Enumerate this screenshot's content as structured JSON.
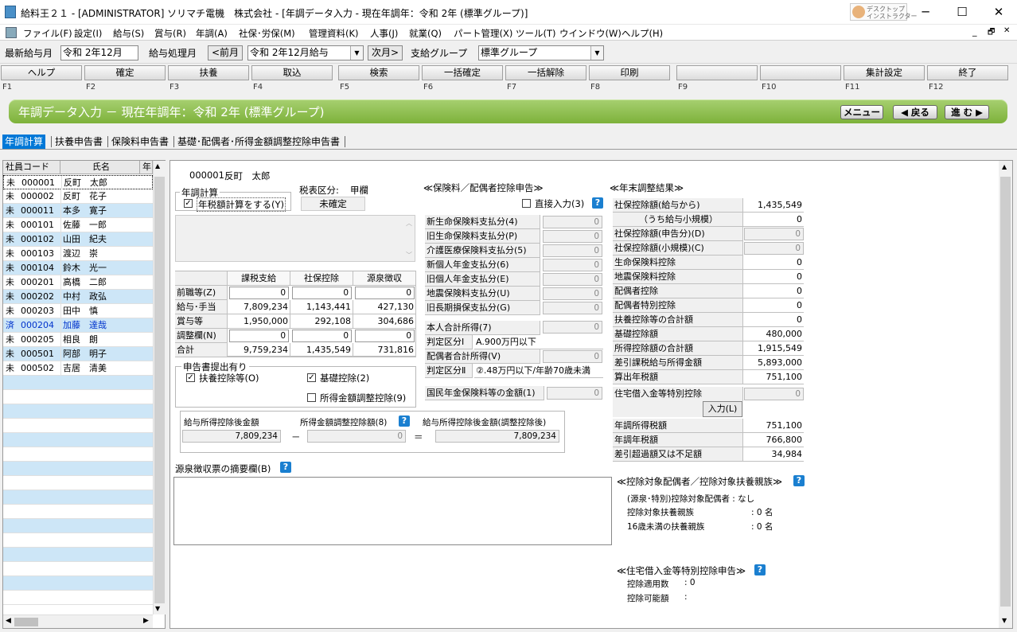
{
  "window": {
    "title": "給料王２１ - [ADMINISTRATOR] ソリマチ電機　株式会社 - [年調データ入力 - 現在年調年：令和 2年 (標準グループ)]",
    "minimize": "─",
    "maximize": "☐",
    "close": "✕",
    "helper_line1": "デスクトップ",
    "helper_line2": "インストラクター"
  },
  "menu": [
    "ファイル(F)",
    "設定(I)",
    "給与(S)",
    "賞与(R)",
    "年調(A)",
    "社保･労保(M)",
    "管理資料(K)",
    "人事(J)",
    "就業(Q)",
    "パート管理(X)",
    "ツール(T)",
    "ウインドウ(W)",
    "ヘルプ(H)"
  ],
  "mdi": {
    "min": "_",
    "restore": "🗗",
    "close": "✕"
  },
  "toolbar": {
    "latest_label": "最新給与月",
    "latest_value": "令和 2年12月",
    "proc_label": "給与処理月",
    "prev": "<前月",
    "proc_value": "令和 2年12月給与",
    "next": "次月>",
    "group_label": "支給グループ",
    "group_value": "標準グループ"
  },
  "fkeys": [
    {
      "label": "ヘルプ",
      "key": "F1"
    },
    {
      "label": "確定",
      "key": "F2"
    },
    {
      "label": "扶養",
      "key": "F3"
    },
    {
      "label": "取込",
      "key": "F4"
    },
    {
      "label": "検索",
      "key": "F5"
    },
    {
      "label": "一括確定",
      "key": "F6"
    },
    {
      "label": "一括解除",
      "key": "F7"
    },
    {
      "label": "印刷",
      "key": "F8"
    },
    {
      "label": "",
      "key": "F9"
    },
    {
      "label": "",
      "key": "F10"
    },
    {
      "label": "集計設定",
      "key": "F11"
    },
    {
      "label": "終了",
      "key": "F12"
    }
  ],
  "header": {
    "title": "年調データ入力 － 現在年調年：令和 2年 (標準グループ)",
    "menu_btn": "メニュー",
    "back_btn": "◀ 戻る",
    "next_btn": "進 む ▶"
  },
  "tabs": [
    "年調計算",
    "扶養申告書",
    "保険料申告書",
    "基礎･配偶者･所得金額調整控除申告書"
  ],
  "list": {
    "headers": [
      "社員コード",
      "氏名",
      "年"
    ],
    "rows": [
      {
        "status": "未",
        "code": "000001",
        "name": "反町　太郎"
      },
      {
        "status": "未",
        "code": "000002",
        "name": "反町　花子"
      },
      {
        "status": "未",
        "code": "000011",
        "name": "本多　寛子"
      },
      {
        "status": "未",
        "code": "000101",
        "name": "佐藤　一郎"
      },
      {
        "status": "未",
        "code": "000102",
        "name": "山田　紀夫"
      },
      {
        "status": "未",
        "code": "000103",
        "name": "渡辺　崇"
      },
      {
        "status": "未",
        "code": "000104",
        "name": "鈴木　光一"
      },
      {
        "status": "未",
        "code": "000201",
        "name": "高橋　二郎"
      },
      {
        "status": "未",
        "code": "000202",
        "name": "中村　政弘"
      },
      {
        "status": "未",
        "code": "000203",
        "name": "田中　慎"
      },
      {
        "status": "済",
        "code": "000204",
        "name": "加藤　達哉"
      },
      {
        "status": "未",
        "code": "000205",
        "name": "相良　朗"
      },
      {
        "status": "未",
        "code": "000501",
        "name": "阿部　明子"
      },
      {
        "status": "未",
        "code": "000502",
        "name": "吉居　清美"
      }
    ]
  },
  "emp": {
    "code": "000001",
    "name": "反町　太郎",
    "tax_label": "税表区分:",
    "tax_value": "甲欄",
    "status": "未確定",
    "calc_group": "年調計算",
    "calc_check": "年税額計算をする(Y)"
  },
  "income": {
    "cols": [
      "課税支給",
      "社保控除",
      "源泉徴収"
    ],
    "rows": [
      {
        "label": "前職等(Z)",
        "v": [
          "0",
          "0",
          "0"
        ]
      },
      {
        "label": "給与･手当",
        "v": [
          "7,809,234",
          "1,143,441",
          "427,130"
        ]
      },
      {
        "label": "賞与等",
        "v": [
          "1,950,000",
          "292,108",
          "304,686"
        ]
      },
      {
        "label": "調整欄(N)",
        "v": [
          "0",
          "0",
          "0"
        ]
      },
      {
        "label": "合計",
        "v": [
          "9,759,234",
          "1,435,549",
          "731,816"
        ]
      }
    ]
  },
  "submitted": {
    "title": "申告書提出有り",
    "c1": "扶養控除等(O)",
    "c2": "基礎控除(2)",
    "c3": "所得金額調整控除(9)"
  },
  "after": {
    "l1": "給与所得控除後金額",
    "v1": "7,809,234",
    "l2": "所得金額調整控除額(8)",
    "v2": "0",
    "l3": "給与所得控除後金額(調整控除後)",
    "v3": "7,809,234",
    "minus": "－",
    "eq": "＝"
  },
  "memo_label": "源泉徴収票の摘要欄(B)",
  "ins": {
    "title": "≪保険料／配偶者控除申告≫",
    "direct": "直接入力(3)",
    "rows": [
      {
        "label": "新生命保険料支払分(4)",
        "v": "0"
      },
      {
        "label": "旧生命保険料支払分(P)",
        "v": "0"
      },
      {
        "label": "介護医療保険料支払分(5)",
        "v": "0"
      },
      {
        "label": "新個人年金支払分(6)",
        "v": "0"
      },
      {
        "label": "旧個人年金支払分(E)",
        "v": "0"
      },
      {
        "label": "地震保険料支払分(U)",
        "v": "0"
      },
      {
        "label": "旧長期損保支払分(G)",
        "v": "0"
      }
    ],
    "own_income": "本人合計所得(7)",
    "own_v": "0",
    "judge1_l": "判定区分Ⅰ",
    "judge1_v": "A.900万円以下",
    "spouse_income": "配偶者合計所得(V)",
    "spouse_v": "0",
    "judge2_l": "判定区分Ⅱ",
    "judge2_v": "②.48万円以下/年齢70歳未満",
    "pension": "国民年金保険料等の金額(1)",
    "pension_v": "0"
  },
  "result": {
    "title": "≪年末調整結果≫",
    "rows": [
      {
        "label": "社保控除額(給与から)",
        "v": "1,435,549"
      },
      {
        "label": "（うち給与小規模）",
        "v": "0"
      },
      {
        "label": "社保控除額(申告分)(D)",
        "v": "0"
      },
      {
        "label": "社保控除額(小規模)(C)",
        "v": "0"
      },
      {
        "label": "生命保険料控除",
        "v": "0"
      },
      {
        "label": "地震保険料控除",
        "v": "0"
      },
      {
        "label": "配偶者控除",
        "v": "0"
      },
      {
        "label": "配偶者特別控除",
        "v": "0"
      },
      {
        "label": "扶養控除等の合計額",
        "v": "0"
      },
      {
        "label": "基礎控除額",
        "v": "480,000"
      },
      {
        "label": "所得控除額の合計額",
        "v": "1,915,549"
      },
      {
        "label": "差引課税給与所得金額",
        "v": "5,893,000"
      },
      {
        "label": "算出年税額",
        "v": "751,100"
      }
    ],
    "housing": "住宅借入金等特別控除",
    "housing_v": "0",
    "input_btn": "入力(L)",
    "rows2": [
      {
        "label": "年調所得税額",
        "v": "751,100"
      },
      {
        "label": "年調年税額",
        "v": "766,800"
      },
      {
        "label": "差引超過額又は不足額",
        "v": "34,984"
      }
    ]
  },
  "fam": {
    "title": "≪控除対象配偶者／控除対象扶養親族≫",
    "l1": "(源泉･特別)控除対象配偶者 : なし",
    "l2": "控除対象扶養親族",
    "v2": ":  0 名",
    "l3": "16歳未満の扶養親族",
    "v3": ":  0 名"
  },
  "loan": {
    "title": "≪住宅借入金等特別控除申告≫",
    "l1": "控除適用数",
    "v1": ":  0",
    "l2": "控除可能額",
    "v2": ":"
  }
}
